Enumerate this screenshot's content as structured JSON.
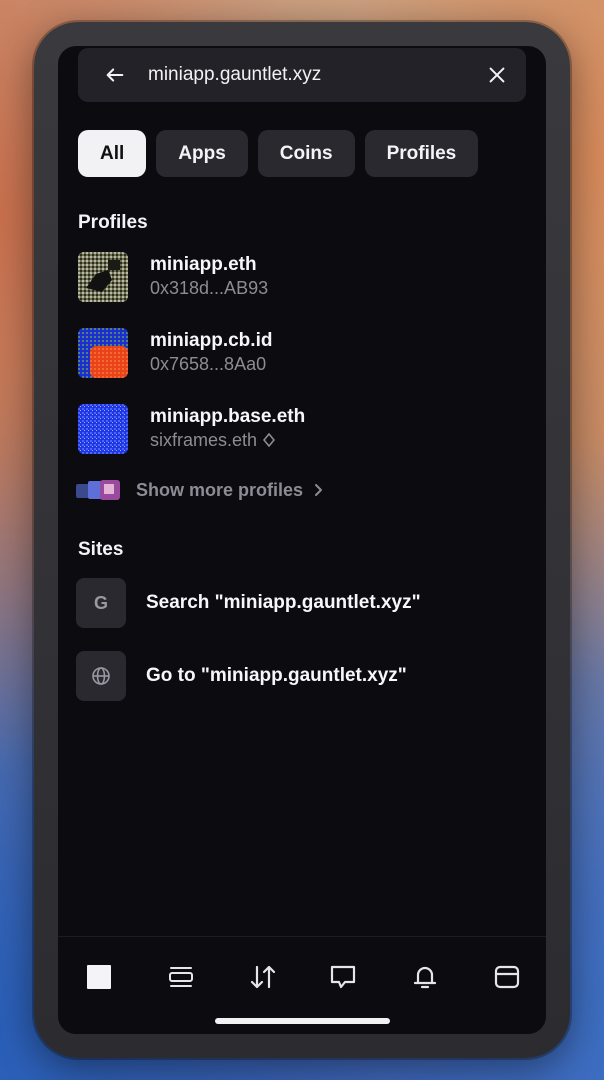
{
  "search": {
    "query": "miniapp.gauntlet.xyz",
    "back_icon": "arrow-left-icon",
    "clear_icon": "close-icon"
  },
  "filters": [
    {
      "label": "All",
      "active": true
    },
    {
      "label": "Apps",
      "active": false
    },
    {
      "label": "Coins",
      "active": false
    },
    {
      "label": "Profiles",
      "active": false
    }
  ],
  "profiles_section": {
    "title": "Profiles",
    "items": [
      {
        "name": "miniapp.eth",
        "sub": "0x318d...AB93"
      },
      {
        "name": "miniapp.cb.id",
        "sub": "0x7658...8Aa0"
      },
      {
        "name": "miniapp.base.eth",
        "sub": "sixframes.eth"
      }
    ],
    "show_more": "Show more profiles"
  },
  "sites_section": {
    "title": "Sites",
    "items": [
      {
        "icon": "google-icon",
        "glyph": "G",
        "label": "Search \"miniapp.gauntlet.xyz\""
      },
      {
        "icon": "globe-icon",
        "label": "Go to \"miniapp.gauntlet.xyz\""
      }
    ]
  },
  "tabbar": {
    "items": [
      "home-icon",
      "feed-icon",
      "swap-icon",
      "chat-icon",
      "bell-icon",
      "wallet-icon"
    ],
    "active": "home-icon"
  },
  "colors": {
    "background": "#0c0b10",
    "surface": "#2a2930",
    "text_primary": "#f7f7f9",
    "text_secondary": "#8d8c94",
    "chip_active": "#f2f2f4"
  }
}
